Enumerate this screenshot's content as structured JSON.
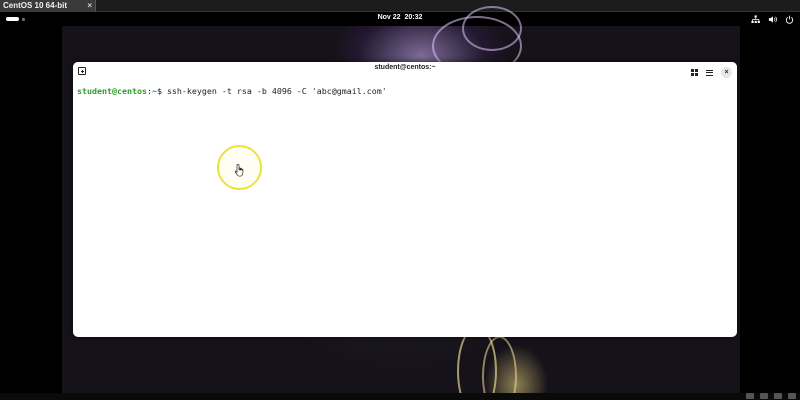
{
  "vm": {
    "tab_title": "CentOS 10 64-bit",
    "tab_close": "×"
  },
  "topbar": {
    "date": "Nov 22",
    "time": "20:32",
    "tray_icons": [
      "network-icon",
      "volume-icon",
      "power-icon"
    ]
  },
  "terminal": {
    "title": "student@centos:~",
    "subtitle": "",
    "close_label": "×",
    "prompt_user": "student@centos",
    "prompt_sep": ":",
    "prompt_path": "~",
    "prompt_symbol": "$ ",
    "command": "ssh-keygen -t rsa -b 4096 -C 'abc@gmail.com'"
  },
  "colors": {
    "prompt_user": "#2e9a2e",
    "prompt_path": "#2a6ad0",
    "cursor_ring": "#e6e63a"
  }
}
